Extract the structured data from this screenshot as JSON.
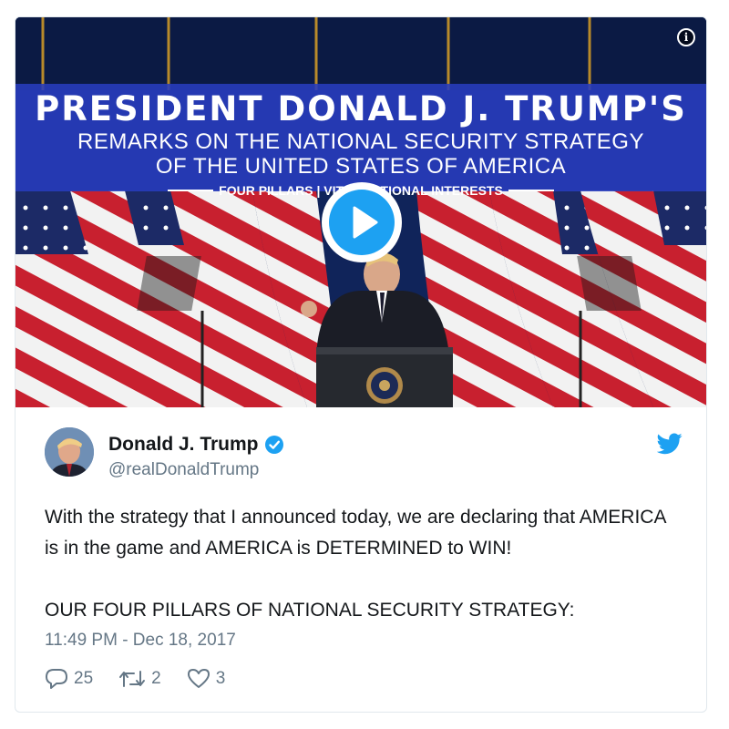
{
  "media": {
    "banner_title": "PRESIDENT DONALD J. TRUMP'S",
    "banner_line1": "REMARKS ON THE NATIONAL SECURITY STRATEGY",
    "banner_line2": "OF THE UNITED STATES OF AMERICA",
    "banner_tagline": "FOUR PILLARS | VITAL NATIONAL INTERESTS",
    "play_icon": "play-icon",
    "info_icon": "info-icon",
    "info_glyph": "i"
  },
  "author": {
    "name": "Donald J. Trump",
    "handle": "@realDonaldTrump",
    "verified_icon": "verified-badge-icon"
  },
  "tweet": {
    "text": "With the strategy that I announced today, we are declaring that AMERICA is in the game and AMERICA is DETERMINED to WIN!\n\nOUR FOUR PILLARS OF NATIONAL SECURITY STRATEGY:",
    "timestamp": "11:49 PM - Dec 18, 2017"
  },
  "actions": {
    "replies": "25",
    "retweets": "2",
    "likes": "3"
  },
  "colors": {
    "accent": "#1da1f2",
    "text": "#14171a",
    "muted": "#657786",
    "banner": "#283cbe"
  }
}
